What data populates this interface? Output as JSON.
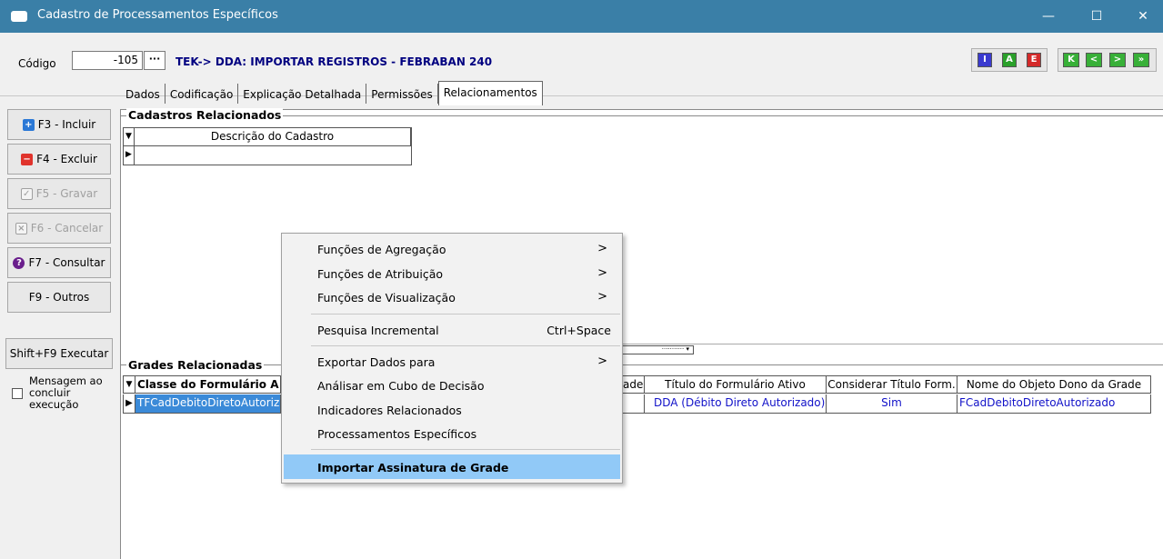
{
  "window": {
    "title": "Cadastro de Processamentos Específicos",
    "minimize": "—",
    "maximize": "☐",
    "close": "✕"
  },
  "header": {
    "code_label": "Código",
    "code_value": "-105",
    "lookup_label": "···",
    "description": "TEK-> DDA: IMPORTAR REGISTROS - FEBRABAN 240",
    "flags": [
      "I",
      "A",
      "E"
    ],
    "nav": [
      "K",
      "<",
      ">",
      "»"
    ]
  },
  "sidebar": {
    "incluir": "F3 - Incluir",
    "excluir": "F4 - Excluir",
    "gravar": "F5 - Gravar",
    "cancelar": "F6 - Cancelar",
    "consultar": "F7 - Consultar",
    "outros": "F9 - Outros",
    "executar": "Shift+F9 Executar",
    "mensagem": "Mensagem ao concluir execução"
  },
  "tabs": [
    "Dados",
    "Codificação",
    "Explicação Detalhada",
    "Permissões",
    "Relacionamentos"
  ],
  "cadastros": {
    "title": "Cadastros Relacionados",
    "column": "Descrição do Cadastro"
  },
  "grades": {
    "title": "Grades Relacionadas",
    "columns": [
      "Classe do Formulário A",
      "ade",
      "Título do Formulário Ativo",
      "Considerar Título Form.",
      "Nome do Objeto Dono da Grade"
    ],
    "row": [
      "TFCadDebitoDiretoAutoriza",
      "",
      "DDA (Débito Direto Autorizado)",
      "Sim",
      "FCadDebitoDiretoAutorizado"
    ]
  },
  "context_menu": {
    "items": [
      {
        "label": "Funções de Agregação",
        "arrow": ">"
      },
      {
        "label": "Funções de Atribuição",
        "arrow": ">"
      },
      {
        "label": "Funções de Visualização",
        "arrow": ">"
      },
      {
        "label": "Pesquisa Incremental",
        "shortcut": "Ctrl+Space"
      },
      {
        "label": "Exportar Dados para",
        "arrow": ">"
      },
      {
        "label": "Análisar em Cubo de Decisão"
      },
      {
        "label": "Indicadores Relacionados"
      },
      {
        "label": "Processamentos Específicos"
      },
      {
        "label": "Importar Assinatura de Grade"
      }
    ]
  },
  "colors": {
    "titlebar": "#3a7fa7",
    "link_blue": "#1010c8",
    "highlight": "#91c9f7"
  }
}
